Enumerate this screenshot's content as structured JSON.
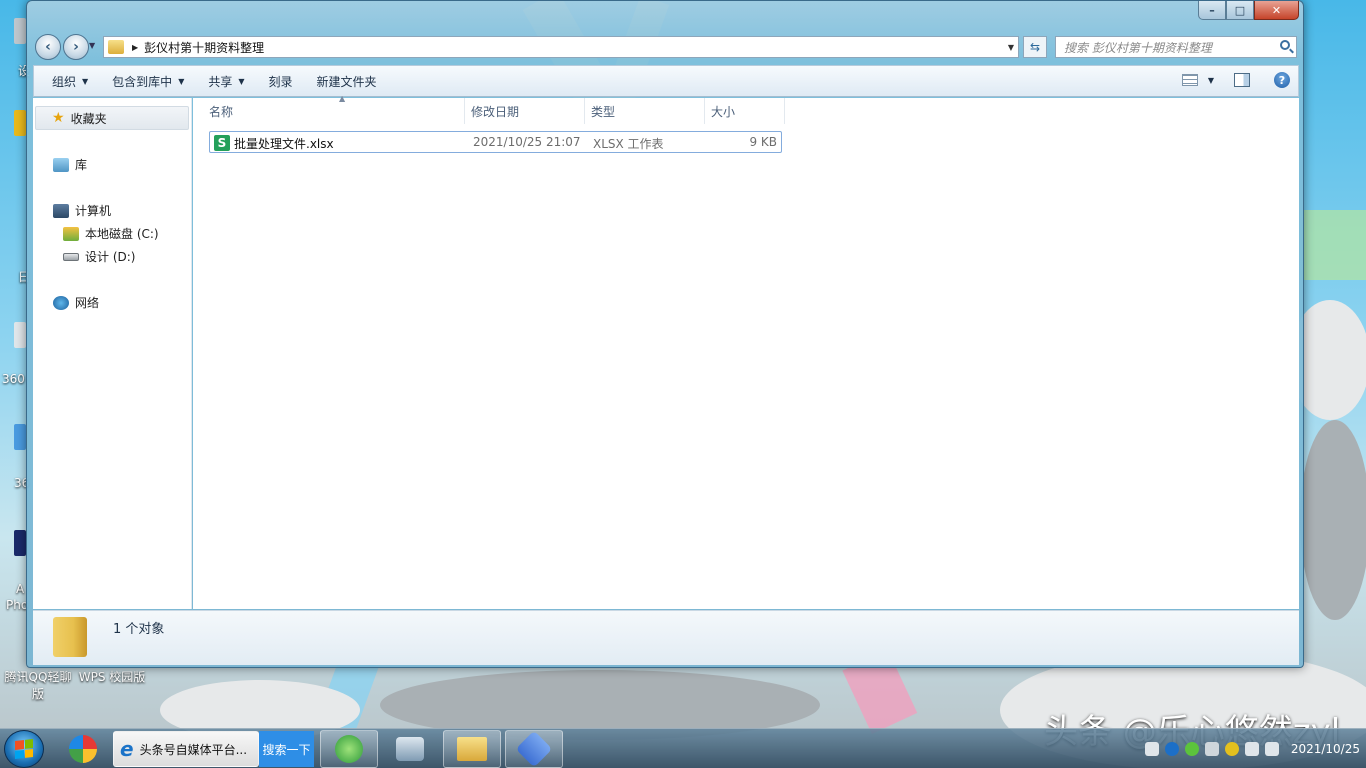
{
  "desktop": {
    "left_labels": [
      "设",
      "日",
      "360",
      "36",
      "A",
      "Pho"
    ],
    "icons": [
      {
        "label": "腾讯QQ轻聊\n版"
      },
      {
        "label": "WPS 校园版"
      }
    ]
  },
  "window": {
    "caption": {
      "min": "–",
      "max": "□",
      "close": "✕"
    },
    "address": {
      "path": "彭仪村第十期资料整理"
    },
    "search": {
      "placeholder": "搜索 彭仪村第十期资料整理"
    },
    "toolbar": {
      "organize": "组织",
      "include_library": "包含到库中",
      "share": "共享",
      "burn": "刻录",
      "new_folder": "新建文件夹"
    },
    "nav": {
      "favorites": "收藏夹",
      "libraries": "库",
      "computer": "计算机",
      "drive_c": "本地磁盘 (C:)",
      "drive_d": "设计 (D:)",
      "network": "网络"
    },
    "columns": {
      "name": "名称",
      "modified": "修改日期",
      "type": "类型",
      "size": "大小"
    },
    "files": [
      {
        "name": "批量处理文件.xlsx",
        "modified": "2021/10/25 21:07",
        "type": "XLSX 工作表",
        "size": "9 KB",
        "icon": "S"
      }
    ],
    "details": {
      "count": "1 个对象"
    }
  },
  "watermark": "头条 @乐心悠然zyl",
  "taskbar": {
    "task_title": "头条号自媒体平台...",
    "search_button": "搜索一下",
    "clock_time": "",
    "clock_date": "2021/10/25"
  },
  "colors": {
    "accent": "#2e8ee6",
    "excel_green": "#24a05a",
    "selection_border": "#84acdd"
  }
}
